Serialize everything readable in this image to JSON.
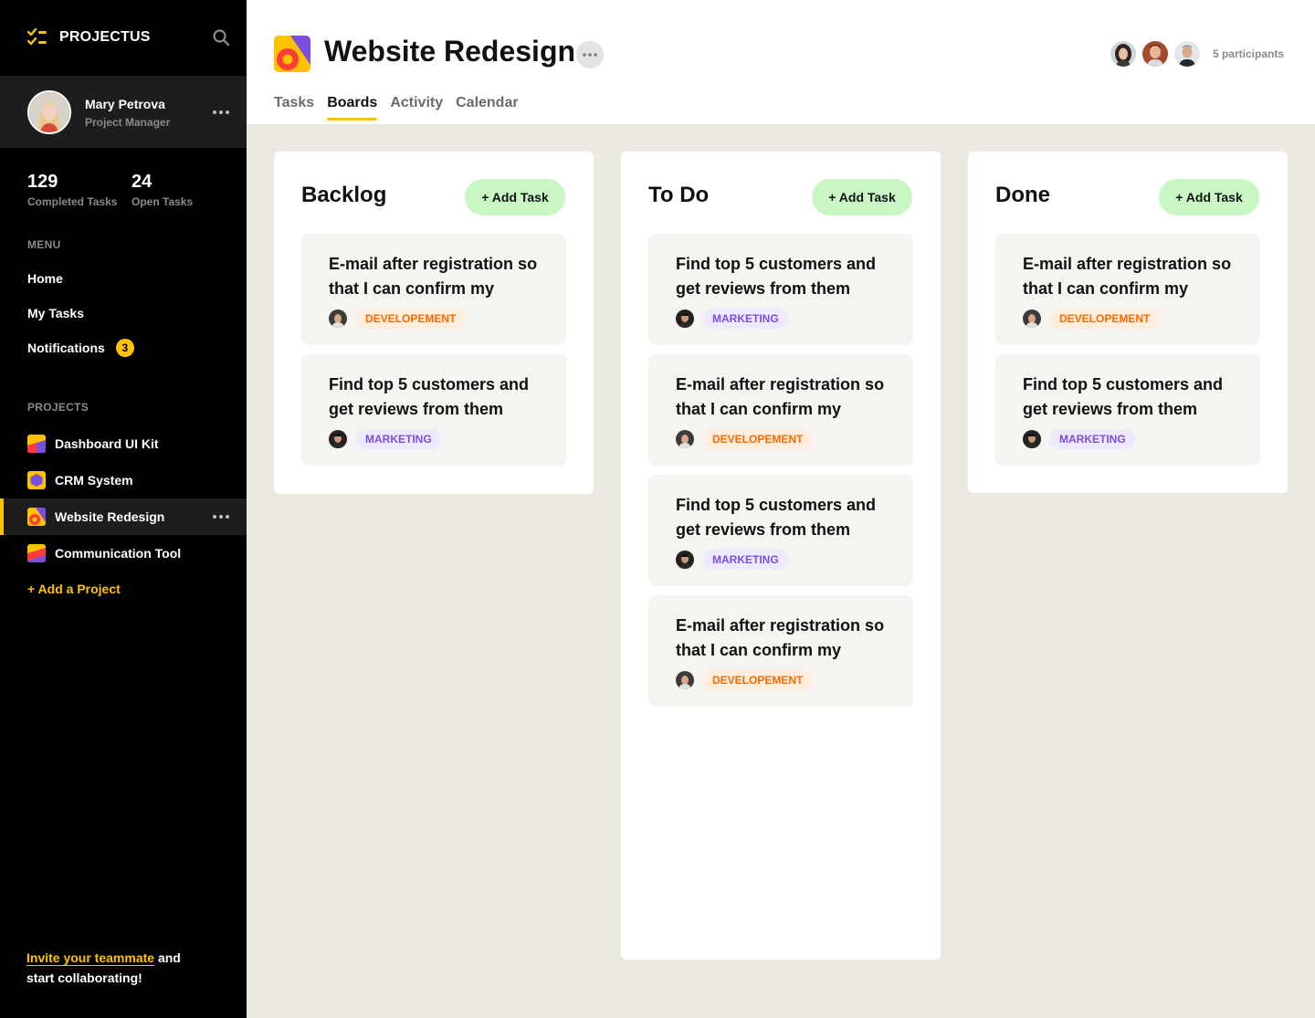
{
  "app": {
    "name": "PROJECTUS"
  },
  "user": {
    "name": "Mary Petrova",
    "role": "Project Manager"
  },
  "stats": [
    {
      "value": "129",
      "label": "Completed Tasks"
    },
    {
      "value": "24",
      "label": "Open Tasks"
    }
  ],
  "menu": {
    "title": "MENU",
    "items": [
      {
        "label": "Home"
      },
      {
        "label": "My Tasks"
      },
      {
        "label": "Notifications",
        "badge": "3"
      }
    ]
  },
  "projects": {
    "title": "PROJECTS",
    "items": [
      {
        "label": "Dashboard UI Kit"
      },
      {
        "label": "CRM System"
      },
      {
        "label": "Website Redesign",
        "active": true
      },
      {
        "label": "Communication Tool"
      }
    ],
    "add_label": "+ Add a Project"
  },
  "invite": {
    "link": "Invite your teammate",
    "text1": " and",
    "text2": "start collaborating!"
  },
  "header": {
    "title": "Website Redesign",
    "tabs": [
      "Tasks",
      "Boards",
      "Activity",
      "Calendar"
    ],
    "active_tab": "Boards",
    "participants": "5 participants"
  },
  "board": {
    "add_label": "+ Add Task",
    "columns": [
      {
        "title": "Backlog",
        "cards": [
          {
            "title": "E-mail after registration so that I can confirm my",
            "tag": "DEVELOPEMENT",
            "type": "dev"
          },
          {
            "title": "Find top 5 customers and get reviews from them",
            "tag": "MARKETING",
            "type": "mkt"
          }
        ]
      },
      {
        "title": "To Do",
        "cards": [
          {
            "title": "Find top 5 customers and get reviews from them",
            "tag": "MARKETING",
            "type": "mkt"
          },
          {
            "title": "E-mail after registration so that I can confirm my",
            "tag": "DEVELOPEMENT",
            "type": "dev"
          },
          {
            "title": "Find top 5 customers and get reviews from them",
            "tag": "MARKETING",
            "type": "mkt"
          },
          {
            "title": "E-mail after registration so that I can confirm my",
            "tag": "DEVELOPEMENT",
            "type": "dev"
          }
        ]
      },
      {
        "title": "Done",
        "cards": [
          {
            "title": "E-mail after registration so that I can confirm my",
            "tag": "DEVELOPEMENT",
            "type": "dev"
          },
          {
            "title": "Find top 5 customers and get reviews from them",
            "tag": "MARKETING",
            "type": "mkt"
          }
        ]
      }
    ]
  },
  "colors": {
    "accent": "#ffc200",
    "sidebar": "#000000",
    "add_task_bg": "#c9f7c4",
    "dev_tag": "#f76a00",
    "mkt_tag": "#7b4ee0",
    "board_bg": "#ece9e2"
  },
  "icons": [
    "checklist-logo-icon",
    "search-icon",
    "more-dots-icon",
    "project-icon"
  ]
}
